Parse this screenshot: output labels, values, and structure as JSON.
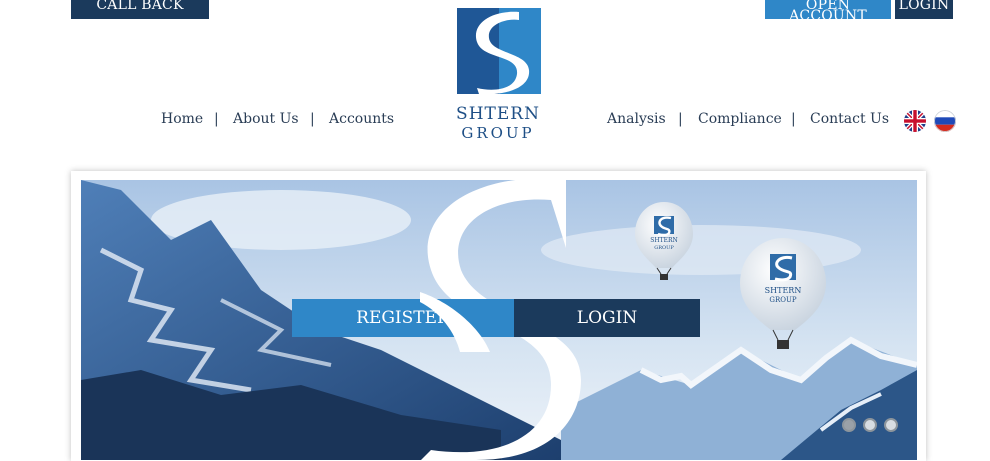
{
  "top": {
    "call_back": "CALL BACK",
    "open_account": "OPEN ACCOUNT",
    "login": "LOGIN"
  },
  "nav_left": [
    "Home",
    "About Us",
    "Accounts"
  ],
  "nav_right": [
    "Analysis",
    "Compliance",
    "Contact Us"
  ],
  "separator": "|",
  "logo": {
    "line1": "SHTERN",
    "line2": "GROUP"
  },
  "hero": {
    "register": "REGISTER",
    "login": "LOGIN",
    "balloon_text1": "SHTERN",
    "balloon_text2": "GROUP",
    "slides": 3,
    "active_slide": 1
  },
  "languages": [
    "english-flag",
    "russian-flag"
  ],
  "colors": {
    "dark": "#1b3a5c",
    "blue": "#2f87c8"
  }
}
